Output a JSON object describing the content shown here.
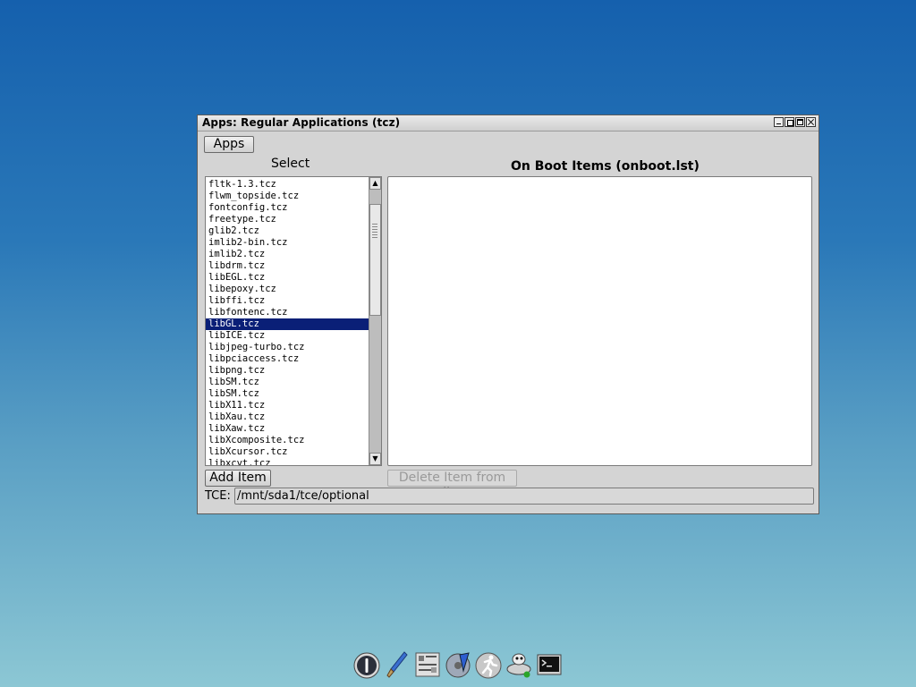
{
  "window": {
    "title": "Apps: Regular Applications (tcz)",
    "apps_button": "Apps",
    "select_label": "Select",
    "onboot_label": "On Boot Items (onboot.lst)",
    "list_items": [
      "fltk-1.3.tcz",
      "flwm_topside.tcz",
      "fontconfig.tcz",
      "freetype.tcz",
      "glib2.tcz",
      "imlib2-bin.tcz",
      "imlib2.tcz",
      "libdrm.tcz",
      "libEGL.tcz",
      "libepoxy.tcz",
      "libffi.tcz",
      "libfontenc.tcz",
      "libGL.tcz",
      "libICE.tcz",
      "libjpeg-turbo.tcz",
      "libpciaccess.tcz",
      "libpng.tcz",
      "libSM.tcz",
      "libSM.tcz",
      "libX11.tcz",
      "libXau.tcz",
      "libXaw.tcz",
      "libXcomposite.tcz",
      "libXcursor.tcz",
      "libxcvt.tcz"
    ],
    "selected_item": "libGL.tcz",
    "add_button": "Add Item",
    "delete_button": "Delete Item from list",
    "tce_label": "TCE:",
    "tce_value": "/mnt/sda1/tce/optional"
  },
  "colors": {
    "selection": "#0a1f77"
  },
  "taskbar": {
    "icons": [
      "power-icon",
      "paintbrush-icon",
      "control-panel-icon",
      "mount-drive-icon",
      "run-icon",
      "apps-install-icon",
      "terminal-icon"
    ]
  }
}
